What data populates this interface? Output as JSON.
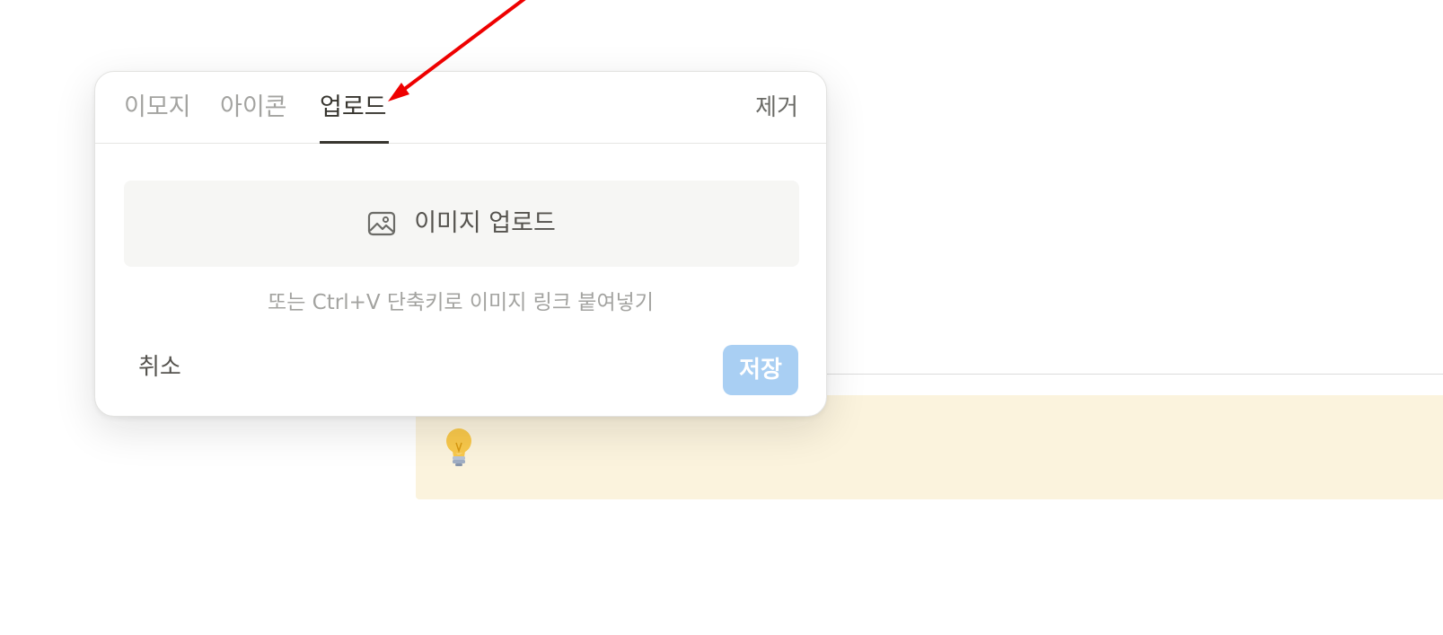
{
  "popover": {
    "tabs": {
      "emoji": "이모지",
      "icon": "아이콘",
      "upload": "업로드"
    },
    "active_tab": "업로드",
    "remove_label": "제거",
    "upload_button_label": "이미지 업로드",
    "upload_icon": "image-icon",
    "hint_text": "또는 Ctrl+V 단축키로 이미지 링크 붙여넣기",
    "cancel_label": "취소",
    "save_label": "저장",
    "save_enabled": false
  },
  "callout": {
    "icon": "lightbulb-icon"
  },
  "annotation": {
    "type": "red arrow",
    "points_to": "업로드",
    "color": "#ee0000"
  },
  "colors": {
    "save_button_bg": "#a9cff3",
    "callout_bg": "#fbf3dd",
    "active_tab_text": "#37352f",
    "inactive_tab_text": "#a3a3a0"
  }
}
